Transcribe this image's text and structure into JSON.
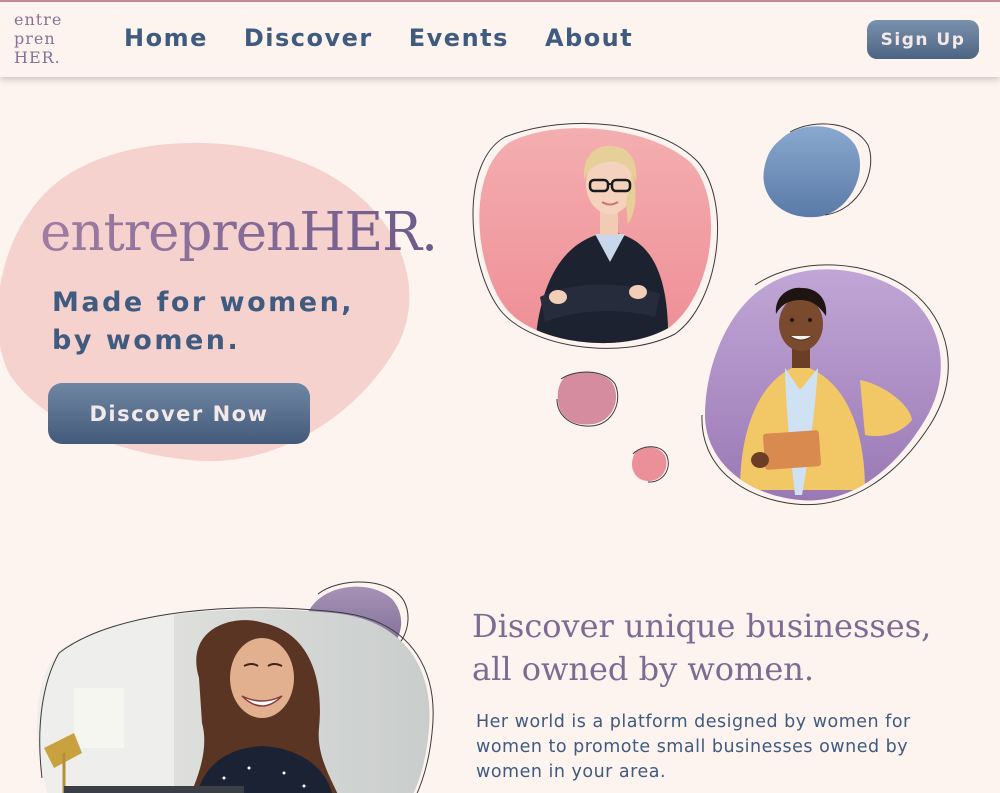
{
  "logo": {
    "line1": "entre",
    "line2": "pren",
    "line3": "HER."
  },
  "nav": {
    "links": [
      "Home",
      "Discover",
      "Events",
      "About"
    ],
    "signup": "Sign Up"
  },
  "hero": {
    "title": "entreprenHER.",
    "subtitle_line1": "Made for women,",
    "subtitle_line2": "by women.",
    "cta": "Discover Now"
  },
  "section": {
    "title_line1": "Discover unique businesses,",
    "title_line2": "all owned by women.",
    "body": "Her world is a platform designed by women for women to promote small businesses owned by women in your area."
  },
  "colors": {
    "background": "#fdf3ef",
    "navy": "#3f5b7f",
    "mauve": "#8b6f96",
    "pink": "#f0a3a7",
    "lavender": "#a98cbf"
  }
}
